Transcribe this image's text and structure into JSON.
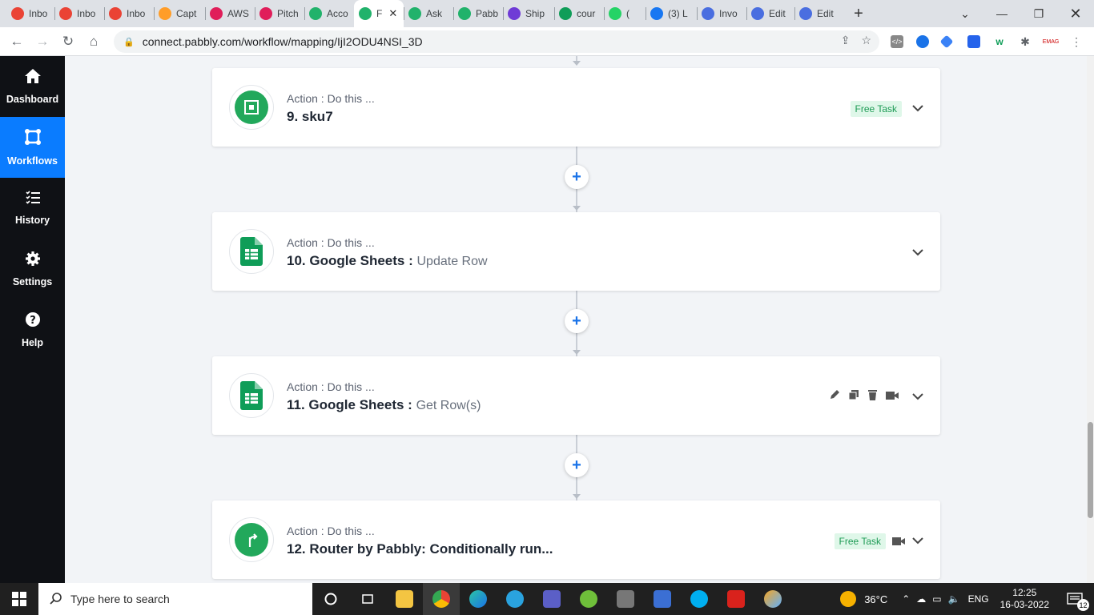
{
  "browser": {
    "tabs": [
      {
        "label": "Inbo",
        "icon": "gmail-icon",
        "color": "#ea4335"
      },
      {
        "label": "Inbo",
        "icon": "gmail-icon",
        "color": "#ea4335"
      },
      {
        "label": "Inbo",
        "icon": "gmail-icon",
        "color": "#ea4335"
      },
      {
        "label": "Capt",
        "icon": "capterra-icon",
        "color": "#ff9d28"
      },
      {
        "label": "AWS",
        "icon": "hashtag-icon",
        "color": "#e01e5a"
      },
      {
        "label": "Pitch",
        "icon": "hashtag-icon",
        "color": "#e01e5a"
      },
      {
        "label": "Acco",
        "icon": "pabbly-icon",
        "color": "#21b26b"
      },
      {
        "label": "F",
        "icon": "pabbly-icon",
        "color": "#21b26b",
        "active": true
      },
      {
        "label": "Ask",
        "icon": "pabbly-icon",
        "color": "#21b26b"
      },
      {
        "label": "Pabb",
        "icon": "pabbly-icon",
        "color": "#21b26b"
      },
      {
        "label": "Ship",
        "icon": "play-icon",
        "color": "#6f3bd6"
      },
      {
        "label": "cour",
        "icon": "plus-square-icon",
        "color": "#0f9d58"
      },
      {
        "label": "(",
        "icon": "whatsapp-icon",
        "color": "#25d366"
      },
      {
        "label": "(3) L",
        "icon": "facebook-icon",
        "color": "#1877f2"
      },
      {
        "label": "Invo",
        "icon": "doc-icon",
        "color": "#4a6ee0"
      },
      {
        "label": "Edit",
        "icon": "doc-icon",
        "color": "#4a6ee0"
      },
      {
        "label": "Edit",
        "icon": "doc-icon",
        "color": "#4a6ee0"
      }
    ],
    "url": "connect.pabbly.com/workflow/mapping/IjI2ODU4NSI_3D"
  },
  "sidebar": {
    "items": [
      {
        "label": "Dashboard",
        "icon": "home-icon"
      },
      {
        "label": "Workflows",
        "icon": "workflow-icon",
        "active": true
      },
      {
        "label": "History",
        "icon": "list-icon"
      },
      {
        "label": "Settings",
        "icon": "gear-icon"
      },
      {
        "label": "Help",
        "icon": "help-icon"
      }
    ]
  },
  "steps": [
    {
      "sub": "Action : Do this ...",
      "title": "9. sku7",
      "event": "",
      "badge": "Free Task",
      "app_icon": "formatter-icon",
      "app_color": "#22a85b"
    },
    {
      "sub": "Action : Do this ...",
      "title": "10. Google Sheets :",
      "event": "Update Row",
      "badge": "",
      "app_icon": "google-sheets-icon",
      "app_color": "#0f9d58"
    },
    {
      "sub": "Action : Do this ...",
      "title": "11. Google Sheets :",
      "event": "Get Row(s)",
      "badge": "",
      "app_icon": "google-sheets-icon",
      "app_color": "#0f9d58"
    },
    {
      "sub": "Action : Do this ...",
      "title": "12. Router by Pabbly: Conditionally run...",
      "event": "",
      "badge": "Free Task",
      "app_icon": "router-icon",
      "app_color": "#22a85b"
    }
  ],
  "taskbar": {
    "search_placeholder": "Type here to search",
    "weather": "36°C",
    "lang": "ENG",
    "time": "12:25",
    "date": "16-03-2022",
    "notifications": "12"
  },
  "colors": {
    "accent": "#0a7cff",
    "sidebar_bg": "#0f1115",
    "free_task": "#1e9b55"
  }
}
